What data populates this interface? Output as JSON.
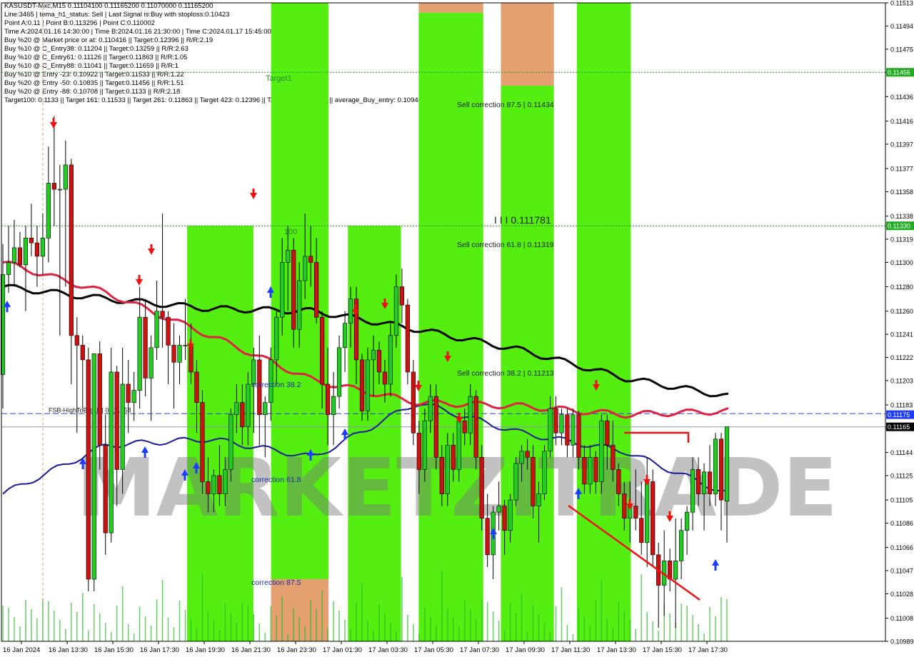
{
  "header_lines": [
    "KASUSDT-Mxc,M15  0.11104100 0.11165200 0.11070000 0.11165200",
    "Line:3465 | tema_h1_status: Sell | Last Signal is:Buy with stoploss:0.10423",
    "Point A:0.11 | Point B:0.113296 | Point C:0.110002",
    "Time A:2024.01.16 14:30:00 | Time B:2024.01.16 21:30:00 | Time C:2024.01.17 15:45:00",
    "Buy %20 @ Market price or at: 0.110416 || Target:0.12396 || R/R:2.19",
    "Buy %10 @ C_Entry38: 0.11204 || Target:0.13259 || R/R:2.63",
    "Buy %10 @ C_Entry61: 0.11126 || Target:0.11863 || R/R:1.05",
    "Buy %10 @ C_Entry88: 0.11041 || Target:0.11659 || R/R:1",
    "Buy %10 @ Entry -23: 0.10922 || Target:0.11533 || R/R:1.22",
    "Buy %20 @ Entry -50: 0.10835 || Target:0.11456 || R/R:1.51",
    "Buy %20 @ Entry -88: 0.10708 || Target:0.1133 || R/R:2.18",
    "Target100: 0.1133 || Target 161: 0.11533 || Target 261: 0.11863 || Target 423: 0.12396 || Target 685: 0.13259 || average_Buy_entry: 0.1094622"
  ],
  "watermark": "MARKETZITRADE",
  "chart_data": {
    "type": "candlestick",
    "symbol": "KASUSDT-Mxc",
    "timeframe": "M15",
    "ylim": [
      0.10989,
      0.11513
    ],
    "y_ticks": [
      "0.11513",
      "0.11494",
      "0.11475",
      "0.11456",
      "0.11436",
      "0.11416",
      "0.11397",
      "0.11377",
      "0.11358",
      "0.11338",
      "0.11319",
      "0.11300",
      "0.11280",
      "0.11260",
      "0.11241",
      "0.11222",
      "0.11203",
      "0.11183",
      "0.11164",
      "0.11144",
      "0.11125",
      "0.11105",
      "0.11086",
      "0.11066",
      "0.11047",
      "0.11028",
      "0.11008",
      "0.10989"
    ],
    "x_ticks": [
      "16 Jan 2024",
      "16 Jan 13:30",
      "16 Jan 15:30",
      "16 Jan 17:30",
      "16 Jan 19:30",
      "16 Jan 21:30",
      "16 Jan 23:30",
      "17 Jan 01:30",
      "17 Jan 03:30",
      "17 Jan 05:30",
      "17 Jan 07:30",
      "17 Jan 09:30",
      "17 Jan 11:30",
      "17 Jan 13:30",
      "17 Jan 15:30",
      "17 Jan 17:30"
    ],
    "price_tags": [
      {
        "label": "0.11456",
        "value": 0.11456,
        "color": "#22aa22"
      },
      {
        "label": "0.11330",
        "value": 0.1133,
        "color": "#22aa22"
      },
      {
        "label": "0.11175",
        "value": 0.11175,
        "color": "#1e3cff"
      },
      {
        "label": "0.11165",
        "value": 0.11165,
        "color": "#000000"
      }
    ],
    "levels": [
      {
        "label": "Target1",
        "value": 0.11456,
        "style": "dotted",
        "color": "#2a8a2a"
      },
      {
        "label": "100",
        "value": 0.1133,
        "style": "dotted",
        "color": "#2a8a2a"
      },
      {
        "label": "FSB-HighToBreak | 0.111758",
        "value": 0.111758,
        "style": "dashed",
        "color": "#3344cc"
      },
      {
        "label": "",
        "value": 0.11165,
        "style": "solid",
        "color": "#8899aa"
      }
    ],
    "annotations": [
      {
        "text": "Sell correction 87.5 | 0.11434",
        "value": 0.11434
      },
      {
        "text": "Sell correction 61.8 | 0.11319",
        "value": 0.11319
      },
      {
        "text": "Sell correction 38.2 | 0.11213",
        "value": 0.11213
      },
      {
        "text": "I I I 0.111781",
        "value": 0.111781
      },
      {
        "text": "correction 38.2",
        "value": 0.11203
      },
      {
        "text": "correction 61.8",
        "value": 0.11125
      },
      {
        "text": "correction 87.5",
        "value": 0.1104
      }
    ],
    "colors": {
      "bull": "#22cc22",
      "bear": "#cc1111",
      "zone_green": "#55ee11",
      "zone_orange": "#e4a070",
      "ema_red": "#dd2244",
      "ema_black": "#000000",
      "ema_blue": "#1a1a99"
    },
    "candles_ohlc": [
      [
        0.11208,
        0.11315,
        0.1118,
        0.1129
      ],
      [
        0.1129,
        0.1133,
        0.11275,
        0.113
      ],
      [
        0.113,
        0.11335,
        0.1128,
        0.11312
      ],
      [
        0.11312,
        0.11325,
        0.11296,
        0.11298
      ],
      [
        0.11298,
        0.1133,
        0.1126,
        0.1132
      ],
      [
        0.1132,
        0.11348,
        0.11305,
        0.11316
      ],
      [
        0.11316,
        0.1133,
        0.1128,
        0.11305
      ],
      [
        0.11305,
        0.1134,
        0.1129,
        0.1132
      ],
      [
        0.1132,
        0.11395,
        0.113,
        0.11365
      ],
      [
        0.11365,
        0.1142,
        0.1133,
        0.1136
      ],
      [
        0.1136,
        0.1138,
        0.1124,
        0.1136
      ],
      [
        0.1136,
        0.114,
        0.1128,
        0.1138
      ],
      [
        0.1138,
        0.11385,
        0.112,
        0.1124
      ],
      [
        0.1124,
        0.11255,
        0.1116,
        0.11232
      ],
      [
        0.11232,
        0.1124,
        0.1118,
        0.1122
      ],
      [
        0.1122,
        0.1123,
        0.1103,
        0.1104
      ],
      [
        0.1104,
        0.112,
        0.1103,
        0.11225
      ],
      [
        0.11225,
        0.11235,
        0.1113,
        0.1115
      ],
      [
        0.1115,
        0.11175,
        0.1106,
        0.11078
      ],
      [
        0.11078,
        0.1123,
        0.1107,
        0.1121
      ],
      [
        0.1121,
        0.11215,
        0.111,
        0.1113
      ],
      [
        0.1113,
        0.1123,
        0.1111,
        0.112
      ],
      [
        0.112,
        0.1122,
        0.1116,
        0.11185
      ],
      [
        0.11185,
        0.1121,
        0.1117,
        0.11195
      ],
      [
        0.11195,
        0.1128,
        0.1118,
        0.11255
      ],
      [
        0.11255,
        0.1127,
        0.1119,
        0.11205
      ],
      [
        0.11205,
        0.1124,
        0.1117,
        0.1123
      ],
      [
        0.1123,
        0.11285,
        0.1122,
        0.1126
      ],
      [
        0.1126,
        0.1134,
        0.1123,
        0.11255
      ],
      [
        0.11255,
        0.1126,
        0.112,
        0.11232
      ],
      [
        0.11232,
        0.1125,
        0.1118,
        0.11218
      ],
      [
        0.11218,
        0.1124,
        0.112,
        0.11232
      ],
      [
        0.11232,
        0.1127,
        0.1122,
        0.11232
      ],
      [
        0.11232,
        0.1125,
        0.112,
        0.1121
      ],
      [
        0.1121,
        0.1122,
        0.1116,
        0.11185
      ],
      [
        0.11185,
        0.11195,
        0.1111,
        0.1112
      ],
      [
        0.1112,
        0.1114,
        0.11095,
        0.1111
      ],
      [
        0.1111,
        0.1113,
        0.11095,
        0.11125
      ],
      [
        0.11125,
        0.1115,
        0.111,
        0.1111
      ],
      [
        0.1111,
        0.1114,
        0.111,
        0.1113
      ],
      [
        0.1113,
        0.1118,
        0.1112,
        0.11175
      ],
      [
        0.11175,
        0.112,
        0.1116,
        0.11185
      ],
      [
        0.11185,
        0.112,
        0.1115,
        0.11165
      ],
      [
        0.11165,
        0.1121,
        0.1115,
        0.112
      ],
      [
        0.112,
        0.1123,
        0.1116,
        0.1122
      ],
      [
        0.1122,
        0.1124,
        0.1115,
        0.11175
      ],
      [
        0.11175,
        0.1119,
        0.1114,
        0.11185
      ],
      [
        0.11185,
        0.1123,
        0.1117,
        0.1122
      ],
      [
        0.1122,
        0.1126,
        0.112,
        0.11255
      ],
      [
        0.11255,
        0.1132,
        0.1124,
        0.113
      ],
      [
        0.113,
        0.1133,
        0.1126,
        0.1131
      ],
      [
        0.1131,
        0.1132,
        0.1123,
        0.11245
      ],
      [
        0.11245,
        0.113,
        0.1123,
        0.11285
      ],
      [
        0.11285,
        0.1134,
        0.1127,
        0.11305
      ],
      [
        0.11305,
        0.1133,
        0.1128,
        0.113
      ],
      [
        0.113,
        0.1132,
        0.1125,
        0.11255
      ],
      [
        0.11255,
        0.1126,
        0.1118,
        0.112
      ],
      [
        0.112,
        0.1123,
        0.1115,
        0.11175
      ],
      [
        0.11175,
        0.1121,
        0.1115,
        0.1119
      ],
      [
        0.1119,
        0.1124,
        0.1118,
        0.1123
      ],
      [
        0.1123,
        0.1126,
        0.1121,
        0.1125
      ],
      [
        0.1125,
        0.1128,
        0.1123,
        0.1127
      ],
      [
        0.1127,
        0.1128,
        0.112,
        0.1122
      ],
      [
        0.1122,
        0.11225,
        0.1117,
        0.11178
      ],
      [
        0.11178,
        0.1123,
        0.1117,
        0.1122
      ],
      [
        0.1122,
        0.1124,
        0.1119,
        0.11228
      ],
      [
        0.11228,
        0.11235,
        0.112,
        0.1121
      ],
      [
        0.1121,
        0.1122,
        0.11185,
        0.112
      ],
      [
        0.112,
        0.1125,
        0.1119,
        0.1124
      ],
      [
        0.1124,
        0.1129,
        0.1123,
        0.1128
      ],
      [
        0.1128,
        0.11295,
        0.1125,
        0.11265
      ],
      [
        0.11265,
        0.1127,
        0.112,
        0.1121
      ],
      [
        0.1121,
        0.1122,
        0.1115,
        0.1116
      ],
      [
        0.1116,
        0.1117,
        0.1111,
        0.1113
      ],
      [
        0.1113,
        0.1118,
        0.1112,
        0.1117
      ],
      [
        0.1117,
        0.112,
        0.1116,
        0.1119
      ],
      [
        0.1119,
        0.112,
        0.1113,
        0.1114
      ],
      [
        0.1114,
        0.1115,
        0.111,
        0.1111
      ],
      [
        0.1111,
        0.1116,
        0.111,
        0.1115
      ],
      [
        0.1115,
        0.1116,
        0.1112,
        0.1113
      ],
      [
        0.1113,
        0.11175,
        0.1112,
        0.1117
      ],
      [
        0.1117,
        0.1118,
        0.1115,
        0.1116
      ],
      [
        0.1116,
        0.112,
        0.1115,
        0.1119
      ],
      [
        0.1119,
        0.11195,
        0.1113,
        0.1114
      ],
      [
        0.1114,
        0.1115,
        0.1108,
        0.1109
      ],
      [
        0.1109,
        0.1111,
        0.1105,
        0.1106
      ],
      [
        0.1106,
        0.111,
        0.1104,
        0.11095
      ],
      [
        0.11095,
        0.1112,
        0.1108,
        0.111
      ],
      [
        0.111,
        0.11105,
        0.1106,
        0.1108
      ],
      [
        0.1108,
        0.1111,
        0.1107,
        0.11105
      ],
      [
        0.11105,
        0.1114,
        0.111,
        0.11135
      ],
      [
        0.11135,
        0.1115,
        0.1112,
        0.11145
      ],
      [
        0.11145,
        0.11155,
        0.1113,
        0.1114
      ],
      [
        0.1114,
        0.1115,
        0.1109,
        0.111
      ],
      [
        0.111,
        0.1112,
        0.1107,
        0.1111
      ],
      [
        0.1111,
        0.1115,
        0.11105,
        0.11145
      ],
      [
        0.11145,
        0.1119,
        0.1114,
        0.1118
      ],
      [
        0.1118,
        0.1119,
        0.1115,
        0.1116
      ],
      [
        0.1116,
        0.1118,
        0.1115,
        0.11175
      ],
      [
        0.11175,
        0.1118,
        0.1114,
        0.1115
      ],
      [
        0.1115,
        0.1118,
        0.1114,
        0.11175
      ],
      [
        0.11175,
        0.11178,
        0.1113,
        0.1114
      ],
      [
        0.1114,
        0.1115,
        0.1111,
        0.11118
      ],
      [
        0.11118,
        0.1115,
        0.1111,
        0.1114
      ],
      [
        0.1114,
        0.11145,
        0.1111,
        0.1112
      ],
      [
        0.1112,
        0.11175,
        0.1111,
        0.1117
      ],
      [
        0.1117,
        0.11175,
        0.1113,
        0.1115
      ],
      [
        0.1115,
        0.1117,
        0.1112,
        0.1113
      ],
      [
        0.1113,
        0.11135,
        0.111,
        0.1111
      ],
      [
        0.1111,
        0.1112,
        0.1108,
        0.1109
      ],
      [
        0.1109,
        0.1112,
        0.1107,
        0.111
      ],
      [
        0.111,
        0.1113,
        0.1108,
        0.1109
      ],
      [
        0.1109,
        0.1112,
        0.1106,
        0.1107
      ],
      [
        0.1107,
        0.1114,
        0.1105,
        0.1112
      ],
      [
        0.1112,
        0.1113,
        0.1105,
        0.1106
      ],
      [
        0.1106,
        0.1107,
        0.11,
        0.11035
      ],
      [
        0.11035,
        0.1108,
        0.1101,
        0.11055
      ],
      [
        0.11055,
        0.11065,
        0.1103,
        0.1104
      ],
      [
        0.1104,
        0.1109,
        0.11,
        0.11055
      ],
      [
        0.11055,
        0.1109,
        0.1104,
        0.1108
      ],
      [
        0.1108,
        0.111,
        0.1106,
        0.11095
      ],
      [
        0.11095,
        0.1114,
        0.1108,
        0.1113
      ],
      [
        0.1113,
        0.1114,
        0.111,
        0.1111
      ],
      [
        0.1111,
        0.11135,
        0.1108,
        0.11128
      ],
      [
        0.11128,
        0.1115,
        0.111,
        0.1111
      ],
      [
        0.1111,
        0.1116,
        0.111,
        0.11155
      ],
      [
        0.11155,
        0.1116,
        0.1108,
        0.11105
      ],
      [
        0.11104,
        0.11165,
        0.1107,
        0.11165
      ]
    ],
    "ema_red": [
      0.113,
      0.11275,
      0.1124,
      0.11203,
      0.11185,
      0.11182,
      0.11175,
      0.11178
    ],
    "ema_black": [
      0.1128,
      0.1127,
      0.11262,
      0.1126,
      0.11245,
      0.11228,
      0.11205,
      0.1119
    ],
    "ema_blue": [
      0.1111,
      0.1115,
      0.11155,
      0.1114,
      0.11185,
      0.1116,
      0.11145,
      0.1111
    ],
    "zones": [
      {
        "x0": 0.21,
        "x1": 0.285,
        "top": 0.1133,
        "bottom": 0.10989,
        "kind": "green"
      },
      {
        "x0": 0.305,
        "x1": 0.37,
        "top": 0.11513,
        "bottom": 0.1104,
        "kind": "green"
      },
      {
        "x0": 0.305,
        "x1": 0.37,
        "top": 0.1104,
        "bottom": 0.10989,
        "kind": "orange"
      },
      {
        "x0": 0.392,
        "x1": 0.452,
        "top": 0.1133,
        "bottom": 0.10989,
        "kind": "green"
      },
      {
        "x0": 0.472,
        "x1": 0.545,
        "top": 0.11505,
        "bottom": 0.10989,
        "kind": "green"
      },
      {
        "x0": 0.472,
        "x1": 0.545,
        "top": 0.11513,
        "bottom": 0.11505,
        "kind": "orange"
      },
      {
        "x0": 0.565,
        "x1": 0.625,
        "top": 0.11445,
        "bottom": 0.10989,
        "kind": "green"
      },
      {
        "x0": 0.565,
        "x1": 0.625,
        "top": 0.11513,
        "bottom": 0.11445,
        "kind": "orange"
      },
      {
        "x0": 0.651,
        "x1": 0.712,
        "top": 0.11513,
        "bottom": 0.10989,
        "kind": "green"
      }
    ]
  }
}
